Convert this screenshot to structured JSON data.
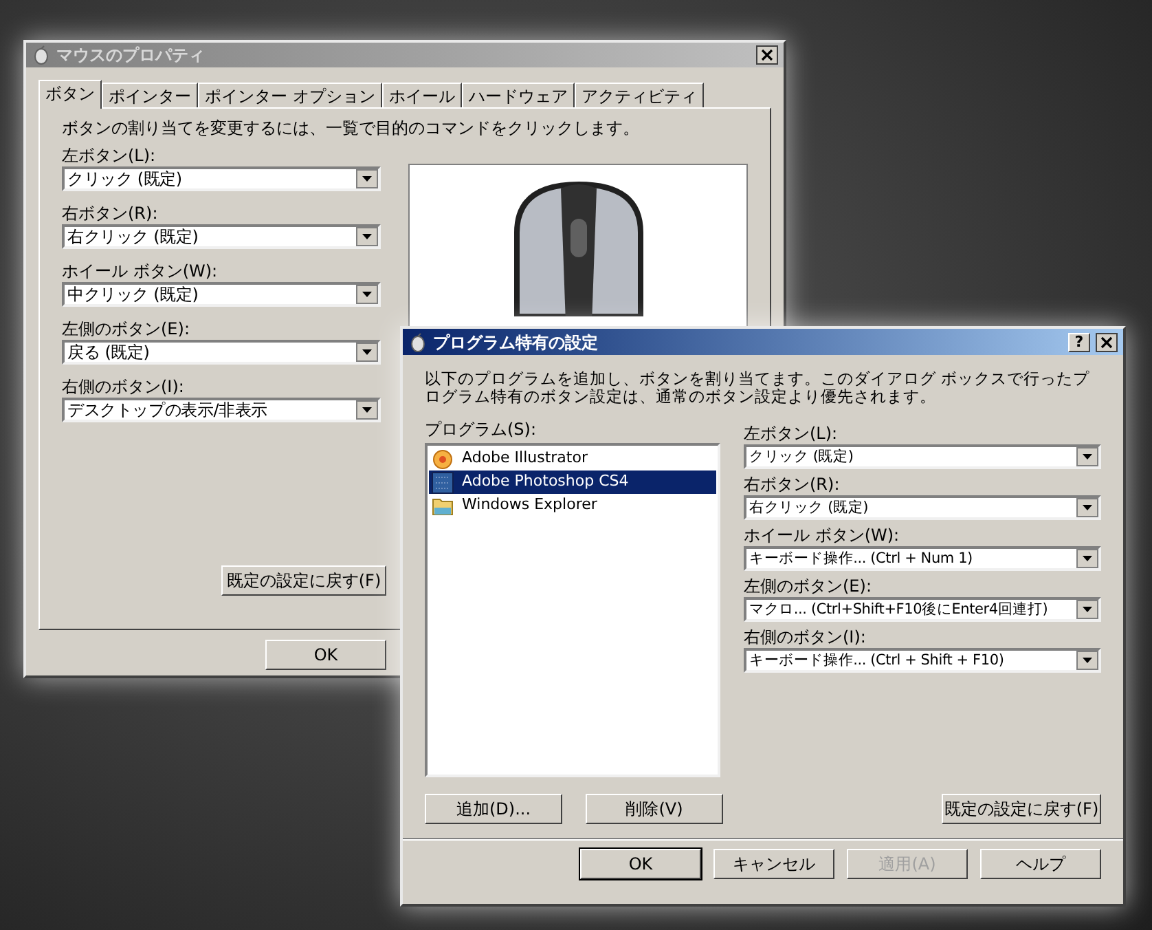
{
  "back_window": {
    "title": "マウスのプロパティ",
    "tabs": [
      {
        "label": "ボタン",
        "selected": true
      },
      {
        "label": "ポインター",
        "selected": false
      },
      {
        "label": "ポインター オプション",
        "selected": false
      },
      {
        "label": "ホイール",
        "selected": false
      },
      {
        "label": "ハードウェア",
        "selected": false
      },
      {
        "label": "アクティビティ",
        "selected": false
      }
    ],
    "description": "ボタンの割り当てを変更するには、一覧で目的のコマンドをクリックします。",
    "fields": [
      {
        "label": "左ボタン(L):",
        "value": "クリック (既定)"
      },
      {
        "label": "右ボタン(R):",
        "value": "右クリック (既定)"
      },
      {
        "label": "ホイール ボタン(W):",
        "value": "中クリック (既定)"
      },
      {
        "label": "左側のボタン(E):",
        "value": "戻る (既定)"
      },
      {
        "label": "右側のボタン(I):",
        "value": "デスクトップの表示/非表示"
      }
    ],
    "reset_button": "既定の設定に戻す(F)",
    "ok_button": "OK"
  },
  "front_dialog": {
    "title": "プログラム特有の設定",
    "help_button": "?",
    "description": "以下のプログラムを追加し、ボタンを割り当てます。このダイアログ ボックスで行ったプログラム特有のボタン設定は、通常のボタン設定より優先されます。",
    "programs_label": "プログラム(S):",
    "programs": [
      {
        "name": "Adobe Illustrator",
        "kind": "flower",
        "selected": false
      },
      {
        "name": "Adobe Photoshop CS4",
        "kind": "tile",
        "selected": true
      },
      {
        "name": "Windows Explorer",
        "kind": "folder",
        "selected": false
      }
    ],
    "fields": [
      {
        "label": "左ボタン(L):",
        "value": "クリック (既定)"
      },
      {
        "label": "右ボタン(R):",
        "value": "右クリック (既定)"
      },
      {
        "label": "ホイール ボタン(W):",
        "value": "キーボード操作... (Ctrl + Num 1)"
      },
      {
        "label": "左側のボタン(E):",
        "value": "マクロ... (Ctrl+Shift+F10後にEnter4回連打)"
      },
      {
        "label": "右側のボタン(I):",
        "value": "キーボード操作... (Ctrl + Shift + F10)"
      }
    ],
    "add_button": "追加(D)...",
    "delete_button": "削除(V)",
    "reset_button": "既定の設定に戻す(F)",
    "buttons": [
      {
        "label": "OK",
        "disabled": false,
        "default": true
      },
      {
        "label": "キャンセル",
        "disabled": false,
        "default": false
      },
      {
        "label": "適用(A)",
        "disabled": true,
        "default": false
      },
      {
        "label": "ヘルプ",
        "disabled": false,
        "default": false
      }
    ]
  }
}
